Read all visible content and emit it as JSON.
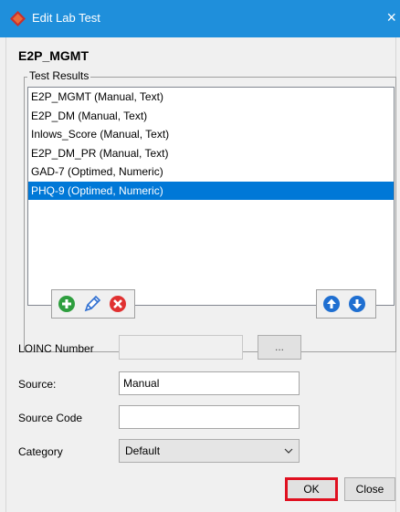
{
  "window": {
    "title": "Edit Lab Test",
    "close_glyph": "×"
  },
  "dialog": {
    "heading": "E2P_MGMT"
  },
  "test_results": {
    "group_label": "Test Results",
    "items": [
      "E2P_MGMT (Manual, Text)",
      "E2P_DM (Manual, Text)",
      "Inlows_Score (Manual, Text)",
      "E2P_DM_PR (Manual, Text)",
      "GAD-7 (Optimed, Numeric)",
      "PHQ-9 (Optimed, Numeric)"
    ],
    "selected_index": 5
  },
  "toolbar": {
    "left_icons": [
      "add-icon",
      "edit-icon",
      "delete-icon"
    ],
    "right_icons": [
      "move-up-icon",
      "move-down-icon"
    ],
    "colors": {
      "add": "#2e9e3e",
      "edit": "#2f6fd1",
      "delete": "#e03030",
      "move": "#1f6fd1"
    }
  },
  "form": {
    "loinc_label": "LOINC Number",
    "loinc_value": "",
    "loinc_button": "...",
    "source_label": "Source:",
    "source_value": "Manual",
    "source_code_label": "Source Code",
    "source_code_value": "",
    "category_label": "Category",
    "category_value": "Default"
  },
  "buttons": {
    "ok": "OK",
    "close": "Close"
  },
  "colors": {
    "titlebar": "#1f8fdb",
    "selection": "#0078d7",
    "ok_highlight": "#e01020"
  }
}
